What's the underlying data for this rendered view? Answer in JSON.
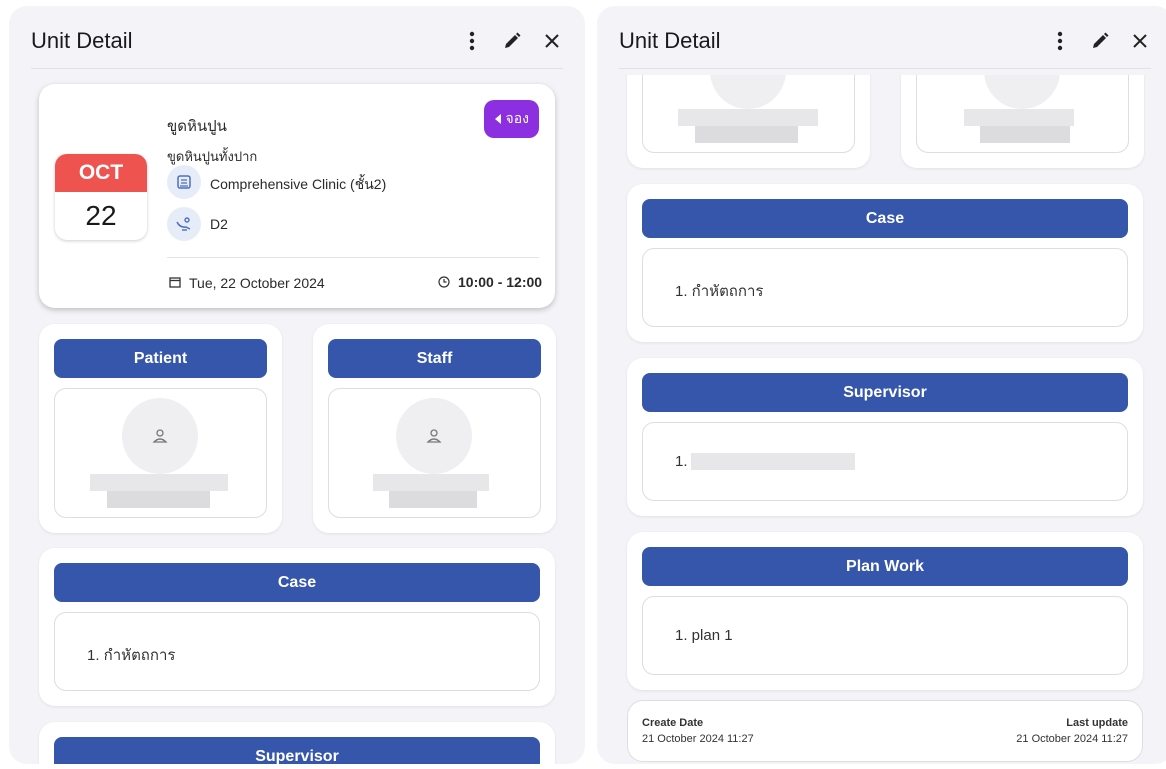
{
  "left": {
    "title": "Unit Detail",
    "appointment": {
      "month": "OCT",
      "day": "22",
      "book_label": "จอง",
      "treatment": "ขูดหินปูน",
      "subtreatment": "ขูดหินปูนทั้งปาก",
      "clinic": "Comprehensive Clinic (ชั้น2)",
      "unit": "D2",
      "date": "Tue, 22 October 2024",
      "time": "10:00 - 12:00"
    },
    "patient_label": "Patient",
    "staff_label": "Staff",
    "case_label": "Case",
    "case_items": [
      "1. กำหัตถการ"
    ],
    "supervisor_label": "Supervisor"
  },
  "right": {
    "title": "Unit Detail",
    "case_label": "Case",
    "case_items": [
      "1. กำหัตถการ"
    ],
    "supervisor_label": "Supervisor",
    "supervisor_items": [
      "1."
    ],
    "plan_label": "Plan Work",
    "plan_items": [
      "1. plan 1"
    ],
    "footer": {
      "create_label": "Create Date",
      "create_value": "21 October 2024 11:27",
      "update_label": "Last update",
      "update_value": "21 October 2024 11:27"
    }
  },
  "colors": {
    "section_blue": "#3556ab",
    "book_purple": "#8b2fe0",
    "month_red": "#ef5350"
  }
}
